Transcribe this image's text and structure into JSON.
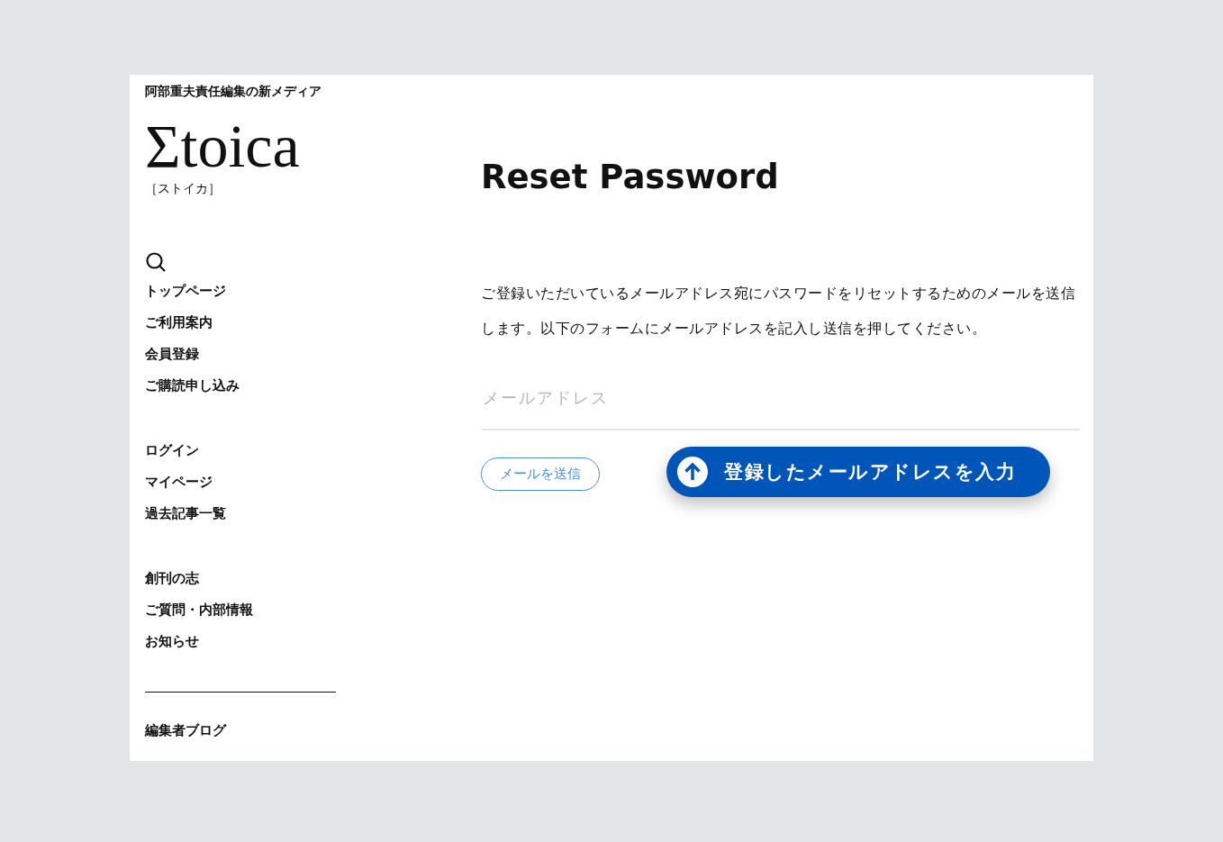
{
  "sidebar": {
    "tagline": "阿部重夫責任編集の新メディア",
    "logo": "Σtoica",
    "logo_reading": "［ストイカ］",
    "nav_groups": [
      [
        "トップページ",
        "ご利用案内",
        "会員登録",
        "ご購読申し込み"
      ],
      [
        "ログイン",
        "マイページ",
        "過去記事一覧"
      ],
      [
        "創刊の志",
        "ご質問・内部情報",
        "お知らせ"
      ]
    ],
    "footer_link": "編集者ブログ"
  },
  "main": {
    "title": "Reset Password",
    "description": "ご登録いただいているメールアドレス宛にパスワードをリセットするためのメールを送信します。以下のフォームにメールアドレスを記入し送信を押してください。",
    "email_field": {
      "placeholder": "メールアドレス"
    },
    "submit_button": "メールを送信",
    "callout": "登録したメールアドレスを入力"
  }
}
